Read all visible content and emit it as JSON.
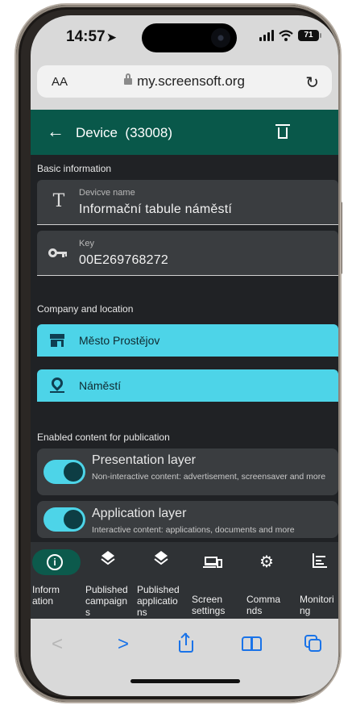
{
  "status_bar": {
    "time": "14:57",
    "battery": "71"
  },
  "browser": {
    "aa_label": "AA",
    "url": "my.screensoft.org"
  },
  "header": {
    "title": "Device  (33008)"
  },
  "basic_info": {
    "section_label": "Basic information",
    "device_name": {
      "label": "Devicve name",
      "value": "Informační tabule náměstí",
      "icon": "text-icon"
    },
    "key": {
      "label": "Key",
      "value": "00E269768272",
      "icon": "key-icon"
    }
  },
  "company_location": {
    "section_label": "Company and location",
    "company": {
      "label": "Město Prostějov",
      "icon": "store-icon"
    },
    "location": {
      "label": "Náměstí",
      "icon": "location-pin-icon"
    }
  },
  "publication": {
    "section_label": "Enabled content for publication",
    "layers": [
      {
        "title": "Presentation layer",
        "description": "Non-interactive content: advertisement, screensaver and more",
        "enabled": true
      },
      {
        "title": "Application layer",
        "description": "Interactive content: applications, documents and more",
        "enabled": true
      }
    ]
  },
  "nav": {
    "items": [
      {
        "label": "Information",
        "icon": "info-icon",
        "active": true
      },
      {
        "label": "Published campaigns",
        "icon": "layers-icon",
        "active": false
      },
      {
        "label": "Published applications",
        "icon": "layers-icon",
        "active": false
      },
      {
        "label": "Screen settings",
        "icon": "devices-icon",
        "active": false
      },
      {
        "label": "Commands",
        "icon": "gear-icon",
        "active": false
      },
      {
        "label": "Monitoring",
        "icon": "monitoring-icon",
        "active": false
      }
    ]
  },
  "colors": {
    "header_bg": "#09584a",
    "accent_cyan": "#4dd4e8",
    "screen_bg": "#202225",
    "field_bg": "#3a3d40",
    "safari_blue": "#1a73e8"
  }
}
